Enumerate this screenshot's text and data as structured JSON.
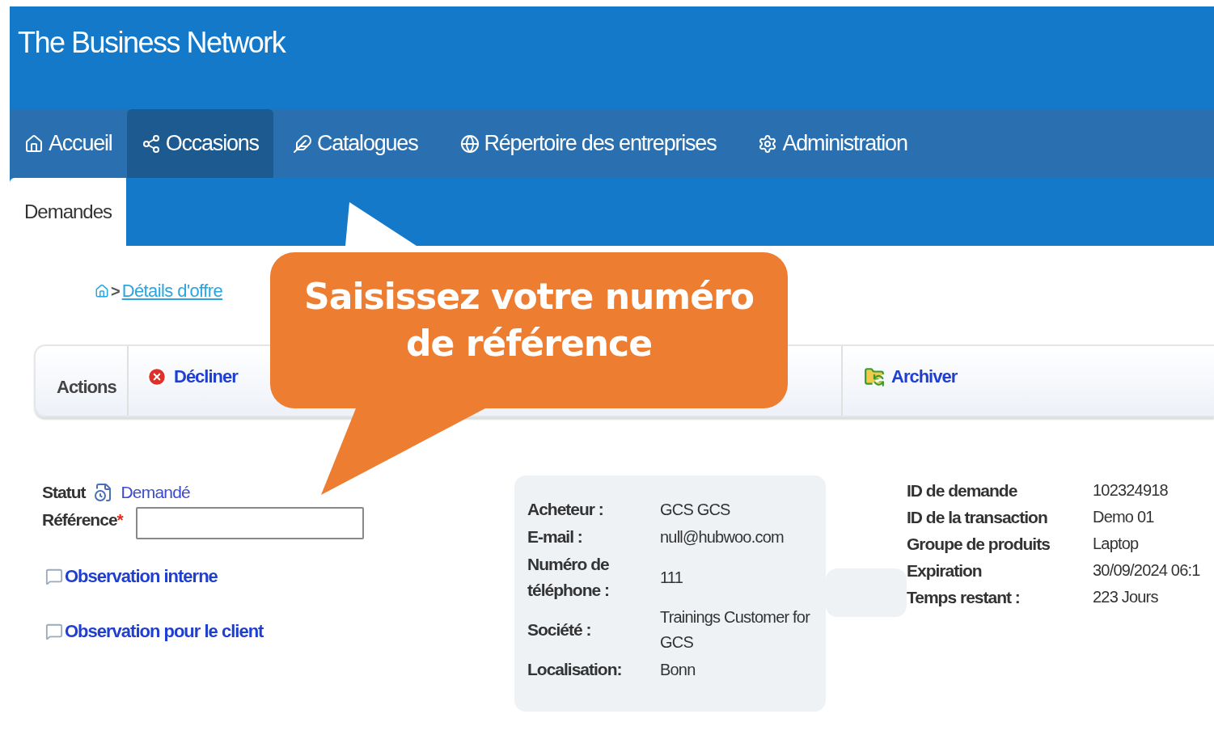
{
  "header": {
    "title": "The Business Network"
  },
  "nav": {
    "tabs": [
      {
        "label": "Accueil",
        "selected": false
      },
      {
        "label": "Occasions",
        "selected": true
      },
      {
        "label": "Catalogues",
        "selected": false
      },
      {
        "label": "Répertoire des entreprises",
        "selected": false
      },
      {
        "label": "Administration",
        "selected": false
      }
    ]
  },
  "subnav": {
    "tabs": [
      {
        "label": "Demandes",
        "selected": true
      }
    ]
  },
  "breadcrumb": {
    "separator": ">",
    "link": "Détails d'offre"
  },
  "actions": {
    "label": "Actions",
    "items": [
      {
        "label": "Décliner",
        "kind": "decline"
      },
      {
        "label": "Archiver",
        "kind": "archive"
      }
    ]
  },
  "callout": {
    "text": "Saisissez votre numéro de référence"
  },
  "form": {
    "status": {
      "label": "Statut",
      "value": "Demandé"
    },
    "reference": {
      "label": "Référence",
      "required_mark": "*"
    },
    "links": [
      {
        "label": "Observation interne"
      },
      {
        "label": "Observation pour le client"
      }
    ]
  },
  "buyer_card": {
    "rows": [
      {
        "label": "Acheteur :",
        "value": "GCS GCS"
      },
      {
        "label": "E-mail :",
        "value": "null@hubwoo.com"
      },
      {
        "label": "Numéro de téléphone :",
        "value": "111"
      },
      {
        "label": "Société :",
        "value": "Trainings Customer for GCS"
      },
      {
        "label": "Localisation:",
        "value": "Bonn"
      }
    ]
  },
  "request_details": {
    "rows": [
      {
        "label": "ID de demande",
        "value": "102324918"
      },
      {
        "label": "ID de la transaction",
        "value": "Demo 01"
      },
      {
        "label": "Groupe de produits",
        "value": "Laptop"
      },
      {
        "label": "Expiration",
        "value": "30/09/2024 06:1"
      },
      {
        "label": "Temps restant :",
        "value": "223 Jours"
      }
    ]
  }
}
